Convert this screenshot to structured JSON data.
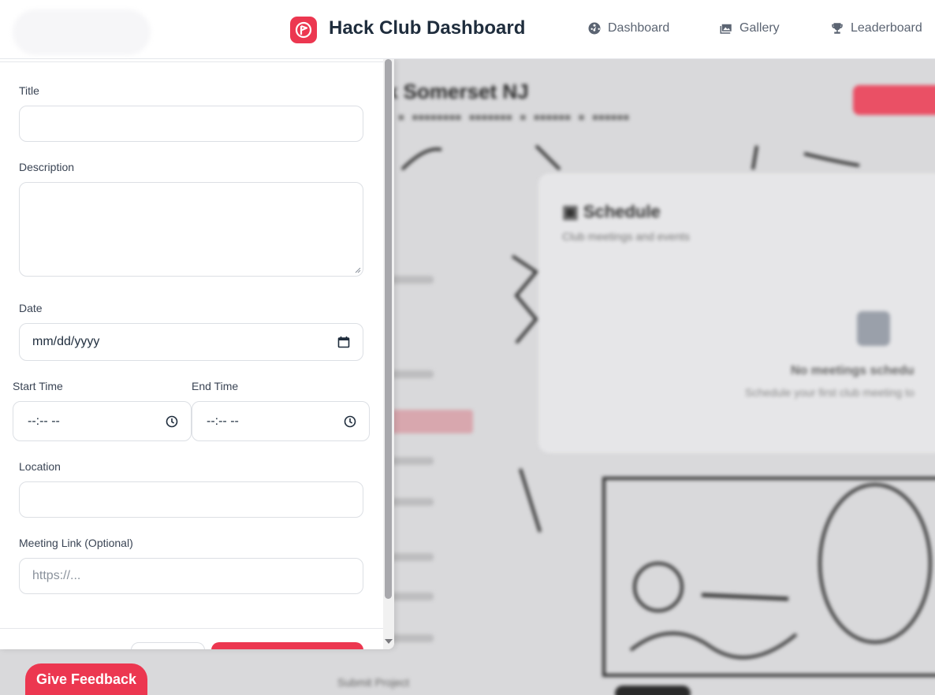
{
  "header": {
    "title": "Hack Club Dashboard",
    "nav": [
      {
        "label": "Dashboard",
        "icon": "gauge-icon"
      },
      {
        "label": "Gallery",
        "icon": "gallery-icon"
      },
      {
        "label": "Leaderboard",
        "icon": "trophy-icon"
      }
    ]
  },
  "background": {
    "page_title": "k Somerset NJ",
    "schedule_title": "Schedule",
    "schedule_subtitle": "Club meetings and events",
    "empty_title": "No meetings schedu",
    "empty_subtitle": "Schedule your first club meeting to",
    "sidebar_bottom": "Submit Project"
  },
  "form": {
    "title_label": "Title",
    "title_value": "",
    "description_label": "Description",
    "description_value": "",
    "date_label": "Date",
    "date_value": "mm/dd/yyyy",
    "start_time_label": "Start Time",
    "start_time_value": "--:-- --",
    "end_time_label": "End Time",
    "end_time_value": "--:-- --",
    "location_label": "Location",
    "location_value": "",
    "meeting_link_label": "Meeting Link (Optional)",
    "meeting_link_placeholder": "https://..."
  },
  "feedback_label": "Give Feedback",
  "colors": {
    "accent": "#ec3750",
    "text": "#1f2d3d",
    "muted": "#5b6472",
    "border": "#dcdfe4"
  }
}
